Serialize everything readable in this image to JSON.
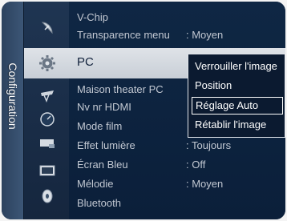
{
  "side_tab": {
    "label": "Configuration"
  },
  "rows_top": [
    {
      "label": "V-Chip",
      "value": ""
    },
    {
      "label": "Transparence menu",
      "value": ": Moyen"
    }
  ],
  "selected_row": {
    "label": "PC"
  },
  "rows_bottom": [
    {
      "label": "Maison theater PC",
      "value": ""
    },
    {
      "label": "Nv nr HDMI",
      "value": ""
    },
    {
      "label": "Mode film",
      "value": ""
    },
    {
      "label": "Effet lumière",
      "value": ": Toujours"
    },
    {
      "label": "Écran Bleu",
      "value": ": Off"
    },
    {
      "label": "Mélodie",
      "value": ": Moyen"
    },
    {
      "label": "Bluetooth",
      "value": ""
    }
  ],
  "popup": {
    "items": [
      "Verrouiller l'image",
      "Position",
      "Réglage Auto",
      "Rétablir l'image"
    ],
    "selected_index": 2
  },
  "icons": [
    "satellite-dish-icon",
    "settings-gear-icon",
    "antenna-icon",
    "clock-icon",
    "input-device-icon",
    "screen-icon",
    "disc-icon"
  ]
}
